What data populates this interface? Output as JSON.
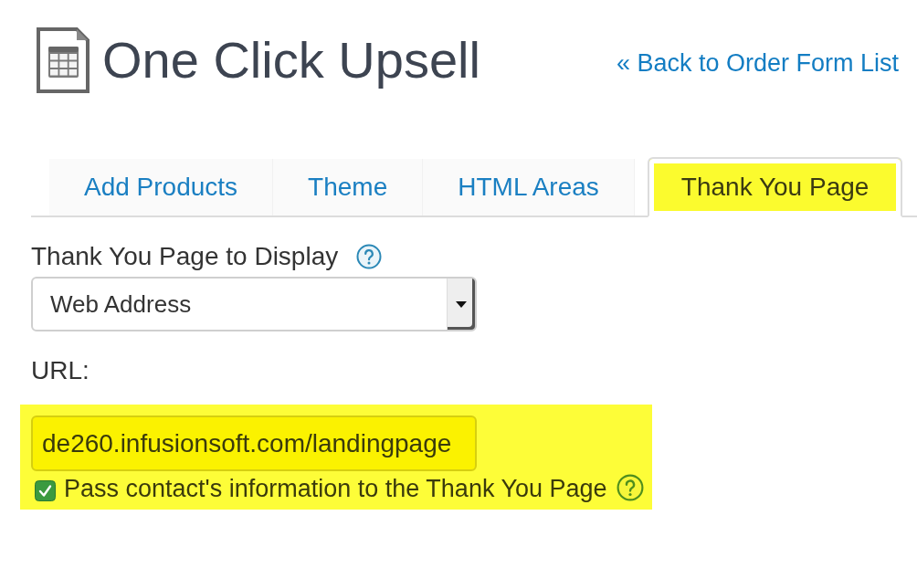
{
  "header": {
    "title": "One Click Upsell",
    "back_link": "« Back to Order Form List"
  },
  "tabs": [
    {
      "label": "Add Products",
      "selected": false,
      "highlighted": false
    },
    {
      "label": "Theme",
      "selected": false,
      "highlighted": false
    },
    {
      "label": "HTML Areas",
      "selected": false,
      "highlighted": false
    },
    {
      "label": "Thank You Page",
      "selected": true,
      "highlighted": true
    }
  ],
  "form": {
    "display": {
      "label": "Thank You Page to Display",
      "value": "Web Address"
    },
    "url_label": "URL:",
    "url_block": {
      "highlighted": true,
      "url_value": "de260.infusionsoft.com/landingpage",
      "pass_contact": {
        "label": "Pass contact's information to the Thank You Page",
        "checked": true
      }
    }
  }
}
